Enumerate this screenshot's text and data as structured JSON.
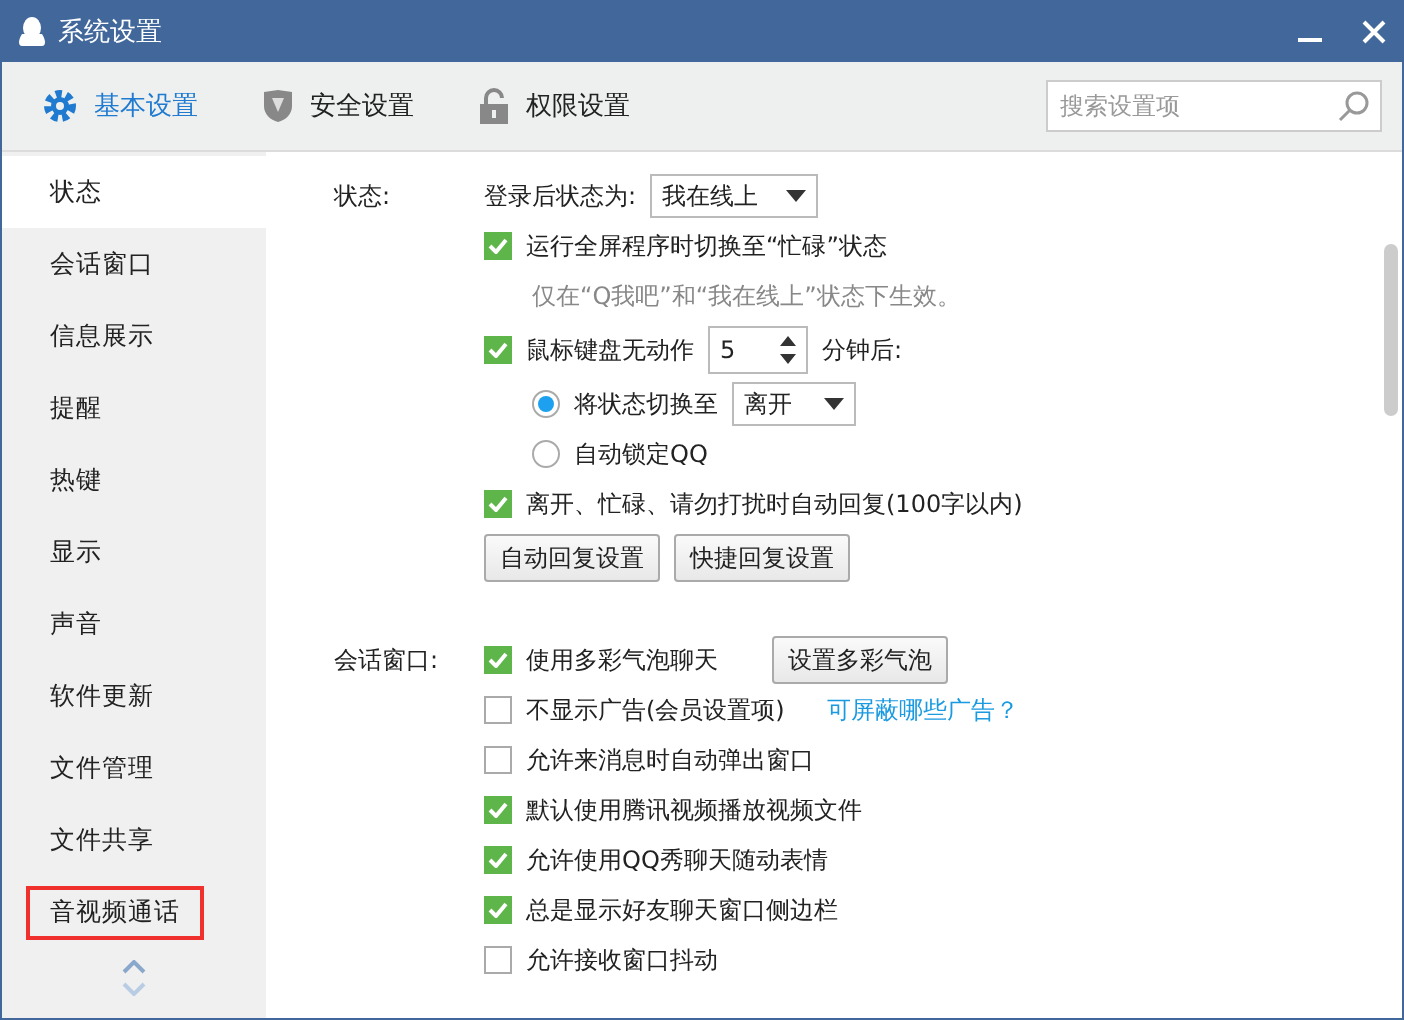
{
  "window": {
    "title": "系统设置"
  },
  "tabs": [
    {
      "label": "基本设置",
      "selected": true,
      "kind": "gear"
    },
    {
      "label": "安全设置",
      "selected": false,
      "kind": "shield"
    },
    {
      "label": "权限设置",
      "selected": false,
      "kind": "lock"
    }
  ],
  "search": {
    "placeholder": "搜索设置项"
  },
  "sidebar": {
    "items": [
      {
        "label": "状态",
        "selected": true,
        "highlighted": false
      },
      {
        "label": "会话窗口",
        "selected": false,
        "highlighted": false
      },
      {
        "label": "信息展示",
        "selected": false,
        "highlighted": false
      },
      {
        "label": "提醒",
        "selected": false,
        "highlighted": false
      },
      {
        "label": "热键",
        "selected": false,
        "highlighted": false
      },
      {
        "label": "显示",
        "selected": false,
        "highlighted": false
      },
      {
        "label": "声音",
        "selected": false,
        "highlighted": false
      },
      {
        "label": "软件更新",
        "selected": false,
        "highlighted": false
      },
      {
        "label": "文件管理",
        "selected": false,
        "highlighted": false
      },
      {
        "label": "文件共享",
        "selected": false,
        "highlighted": false
      },
      {
        "label": "音视频通话",
        "selected": false,
        "highlighted": true
      }
    ]
  },
  "sections": [
    {
      "label": "状态:",
      "rows": [
        {
          "kind": "select",
          "label": "登录后状态为:",
          "value": "我在线上"
        },
        {
          "kind": "checkbox",
          "label": "运行全屏程序时切换至“忙碌”状态",
          "checked": true
        },
        {
          "kind": "note",
          "label": "仅在“Q我吧”和“我在线上”状态下生效。"
        },
        {
          "kind": "spinner",
          "label": "鼠标键盘无动作",
          "value": "5",
          "suffix": "分钟后:",
          "checked": true
        },
        {
          "kind": "radio-select",
          "label": "将状态切换至",
          "value": "离开",
          "selected": true
        },
        {
          "kind": "radio",
          "label": "自动锁定QQ",
          "selected": false
        },
        {
          "kind": "checkbox",
          "label": "离开、忙碌、请勿打扰时自动回复(100字以内)",
          "checked": true
        },
        {
          "kind": "buttons",
          "buttons": [
            "自动回复设置",
            "快捷回复设置"
          ]
        }
      ]
    },
    {
      "label": "会话窗口:",
      "rows": [
        {
          "kind": "checkbox",
          "label": "使用多彩气泡聊天",
          "checked": true,
          "button": "设置多彩气泡"
        },
        {
          "kind": "checkbox",
          "label": "不显示广告(会员设置项)",
          "checked": false,
          "link": "可屏蔽哪些广告？"
        },
        {
          "kind": "checkbox",
          "label": "允许来消息时自动弹出窗口",
          "checked": false
        },
        {
          "kind": "checkbox",
          "label": "默认使用腾讯视频播放视频文件",
          "checked": true
        },
        {
          "kind": "checkbox",
          "label": "允许使用QQ秀聊天随动表情",
          "checked": true
        },
        {
          "kind": "checkbox",
          "label": "总是显示好友聊天窗口侧边栏",
          "checked": true
        },
        {
          "kind": "checkbox",
          "label": "允许接收窗口抖动",
          "checked": false
        }
      ]
    }
  ]
}
